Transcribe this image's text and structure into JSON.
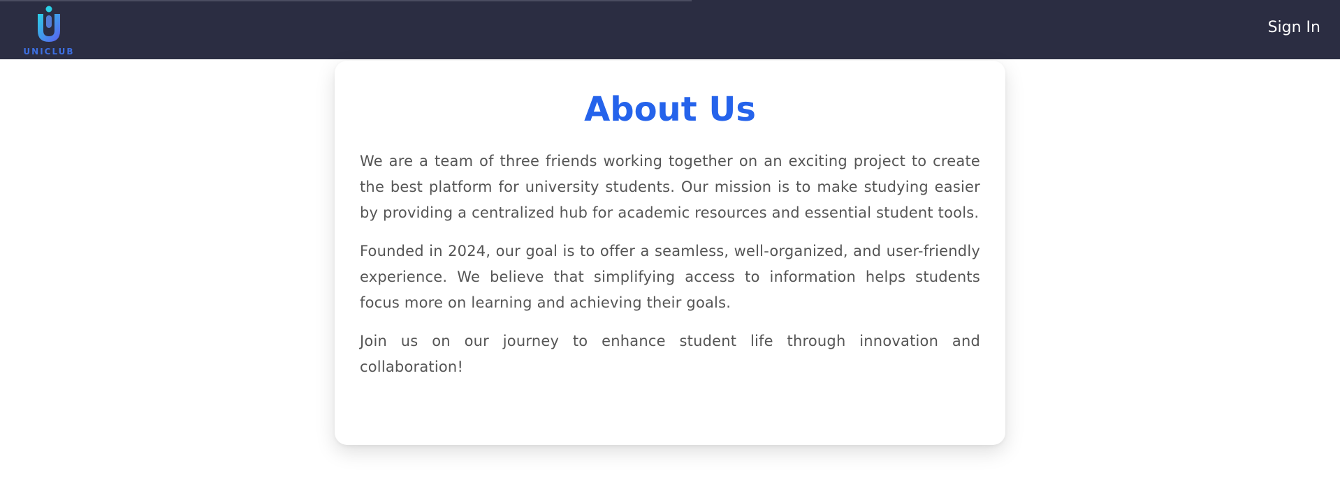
{
  "header": {
    "logo_text": "UNICLUB",
    "sign_in_label": "Sign In"
  },
  "about": {
    "title": "About Us",
    "paragraphs": [
      "We are a team of three friends working together on an exciting project to create the best platform for university students. Our mission is to make studying easier by providing a centralized hub for academic resources and essential student tools.",
      "Founded in 2024, our goal is to offer a seamless, well-organized, and user-friendly experience. We believe that simplifying access to information helps students focus more on learning and achieving their goals.",
      "Join us on our journey to enhance student life through innovation and collaboration!"
    ]
  },
  "colors": {
    "navbar_bg": "#2b2d42",
    "title_blue": "#2563eb",
    "body_text": "#555555",
    "logo_gradient_start": "#2bd0e6",
    "logo_gradient_end": "#5b5cf0"
  }
}
